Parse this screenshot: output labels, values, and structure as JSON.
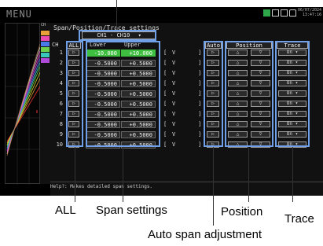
{
  "topbar": {
    "menu": "MENU",
    "date": "06/07/2024",
    "time": "13:47:16"
  },
  "minigraph": {
    "ch_label": "CH"
  },
  "panel": {
    "title": "Span/Position/Trace settings",
    "ch_range": "CH1 - CH10",
    "ch_range_arrow": "▾",
    "headers": {
      "ch": "CH",
      "all": "ALL",
      "lower": "Lower",
      "upper": "Upper",
      "auto": "Auto",
      "position": "Position",
      "trace": "Trace"
    },
    "all_symbol": "▷",
    "up_symbol": "△",
    "down_symbol": "▽",
    "unit_open": "[",
    "unit": "V",
    "unit_close": "]",
    "rows": [
      {
        "ch": "1",
        "lower": "-10.000",
        "upper": "+10.000",
        "trace": "On ▾"
      },
      {
        "ch": "2",
        "lower": "-0.5000",
        "upper": "+0.5000",
        "trace": "On ▾"
      },
      {
        "ch": "3",
        "lower": "-0.5000",
        "upper": "+0.5000",
        "trace": "On ▾"
      },
      {
        "ch": "4",
        "lower": "-0.5000",
        "upper": "+0.5000",
        "trace": "On ▾"
      },
      {
        "ch": "5",
        "lower": "-0.5000",
        "upper": "+0.5000",
        "trace": "On ▾"
      },
      {
        "ch": "6",
        "lower": "-0.5000",
        "upper": "+0.5000",
        "trace": "On ▾"
      },
      {
        "ch": "7",
        "lower": "-0.5000",
        "upper": "+0.5000",
        "trace": "On ▾"
      },
      {
        "ch": "8",
        "lower": "-0.5000",
        "upper": "+0.5000",
        "trace": "On ▾"
      },
      {
        "ch": "9",
        "lower": "-0.5000",
        "upper": "+0.5000",
        "trace": "On ▾"
      },
      {
        "ch": "10",
        "lower": "-0.5000",
        "upper": "+0.5000",
        "trace": "On ▾"
      }
    ],
    "help": "Help?: Makes detailed span settings."
  },
  "annotations": {
    "all": "ALL",
    "span": "Span settings",
    "position": "Position",
    "trace": "Trace",
    "auto": "Auto span adjustment"
  },
  "colors": {
    "highlight": "#3fbf3f",
    "outline": "#6fa0e8"
  }
}
